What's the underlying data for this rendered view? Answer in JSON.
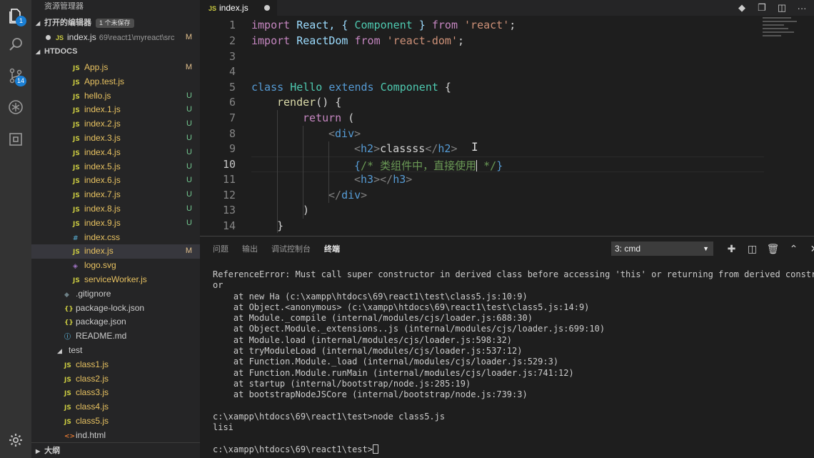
{
  "activity": {
    "explorer_badge": "1",
    "scm_badge": "14",
    "icons": [
      "files-icon",
      "search-icon",
      "source-control-icon",
      "debug-icon",
      "extensions-icon",
      "gear-icon"
    ]
  },
  "sidebar": {
    "title": "资源管理器",
    "open_editors": {
      "label": "打开的编辑器",
      "badge": "1 个未保存",
      "items": [
        {
          "name": "index.js",
          "path": "69\\react1\\myreact\\src",
          "status": "M"
        }
      ]
    },
    "folder": "HTDOCS",
    "files": [
      {
        "name": "App.js",
        "type": "js",
        "status": "M",
        "depth": 3
      },
      {
        "name": "App.test.js",
        "type": "js",
        "status": "",
        "depth": 3
      },
      {
        "name": "hello.js",
        "type": "js",
        "status": "U",
        "depth": 3
      },
      {
        "name": "index.1.js",
        "type": "js",
        "status": "U",
        "depth": 3
      },
      {
        "name": "index.2.js",
        "type": "js",
        "status": "U",
        "depth": 3
      },
      {
        "name": "index.3.js",
        "type": "js",
        "status": "U",
        "depth": 3
      },
      {
        "name": "index.4.js",
        "type": "js",
        "status": "U",
        "depth": 3
      },
      {
        "name": "index.5.js",
        "type": "js",
        "status": "U",
        "depth": 3
      },
      {
        "name": "index.6.js",
        "type": "js",
        "status": "U",
        "depth": 3
      },
      {
        "name": "index.7.js",
        "type": "js",
        "status": "U",
        "depth": 3
      },
      {
        "name": "index.8.js",
        "type": "js",
        "status": "U",
        "depth": 3
      },
      {
        "name": "index.9.js",
        "type": "js",
        "status": "U",
        "depth": 3
      },
      {
        "name": "index.css",
        "type": "css",
        "status": "",
        "depth": 3
      },
      {
        "name": "index.js",
        "type": "js",
        "status": "M",
        "depth": 3,
        "selected": true
      },
      {
        "name": "logo.svg",
        "type": "svg",
        "status": "",
        "depth": 3
      },
      {
        "name": "serviceWorker.js",
        "type": "js",
        "status": "",
        "depth": 3
      },
      {
        "name": ".gitignore",
        "type": "git",
        "status": "",
        "depth": 2
      },
      {
        "name": "package-lock.json",
        "type": "json",
        "status": "",
        "depth": 2
      },
      {
        "name": "package.json",
        "type": "json",
        "status": "",
        "depth": 2
      },
      {
        "name": "README.md",
        "type": "md",
        "status": "",
        "depth": 2
      },
      {
        "name": "test",
        "type": "folder",
        "status": "",
        "depth": 1
      },
      {
        "name": "class1.js",
        "type": "js",
        "status": "",
        "depth": 2
      },
      {
        "name": "class2.js",
        "type": "js",
        "status": "",
        "depth": 2
      },
      {
        "name": "class3.js",
        "type": "js",
        "status": "",
        "depth": 2
      },
      {
        "name": "class4.js",
        "type": "js",
        "status": "",
        "depth": 2
      },
      {
        "name": "class5.js",
        "type": "js",
        "status": "",
        "depth": 2
      },
      {
        "name": "ind.html",
        "type": "html",
        "status": "",
        "depth": 2
      }
    ],
    "outline": "大纲"
  },
  "editor": {
    "tab": "index.js",
    "line_numbers": [
      "1",
      "2",
      "3",
      "4",
      "5",
      "6",
      "7",
      "8",
      "9",
      "10",
      "11",
      "12",
      "13",
      "14"
    ],
    "current_line": "10",
    "code": {
      "l1": [
        "import",
        " React, { ",
        "Component",
        " } ",
        "from",
        " ",
        "'react'",
        ";"
      ],
      "l2": [
        "import",
        " ReactDom ",
        "from",
        " ",
        "'react-dom'",
        ";"
      ],
      "l5": [
        "class",
        " ",
        "Hello",
        " ",
        "extends",
        " ",
        "Component",
        " {"
      ],
      "l6": [
        "render",
        "() {"
      ],
      "l7": [
        "return",
        " ("
      ],
      "l8": [
        "<",
        "div",
        ">"
      ],
      "l9": [
        "<",
        "h2",
        ">",
        "classss",
        "</",
        "h2",
        ">"
      ],
      "l10": [
        "{",
        "/* 类组件中，直接使用",
        " */",
        "}"
      ],
      "l11": [
        "<",
        "h3",
        "></",
        "h3",
        ">"
      ],
      "l12": [
        "</",
        "div",
        ">"
      ],
      "l13": [
        ")"
      ],
      "l14": [
        "}"
      ]
    }
  },
  "panel": {
    "tabs": [
      "问题",
      "输出",
      "调试控制台",
      "终端"
    ],
    "active_tab": "终端",
    "terminal_select": "3: cmd",
    "terminal_lines": [
      "ReferenceError: Must call super constructor in derived class before accessing 'this' or returning from derived construct",
      "or",
      "    at new Ha (c:\\xampp\\htdocs\\69\\react1\\test\\class5.js:10:9)",
      "    at Object.<anonymous> (c:\\xampp\\htdocs\\69\\react1\\test\\class5.js:14:9)",
      "    at Module._compile (internal/modules/cjs/loader.js:688:30)",
      "    at Object.Module._extensions..js (internal/modules/cjs/loader.js:699:10)",
      "    at Module.load (internal/modules/cjs/loader.js:598:32)",
      "    at tryModuleLoad (internal/modules/cjs/loader.js:537:12)",
      "    at Function.Module._load (internal/modules/cjs/loader.js:529:3)",
      "    at Function.Module.runMain (internal/modules/cjs/loader.js:741:12)",
      "    at startup (internal/bootstrap/node.js:285:19)",
      "    at bootstrapNodeJSCore (internal/bootstrap/node.js:739:3)",
      "",
      "c:\\xampp\\htdocs\\69\\react1\\test>node class5.js",
      "lisi",
      "",
      "c:\\xampp\\htdocs\\69\\react1\\test>"
    ]
  }
}
